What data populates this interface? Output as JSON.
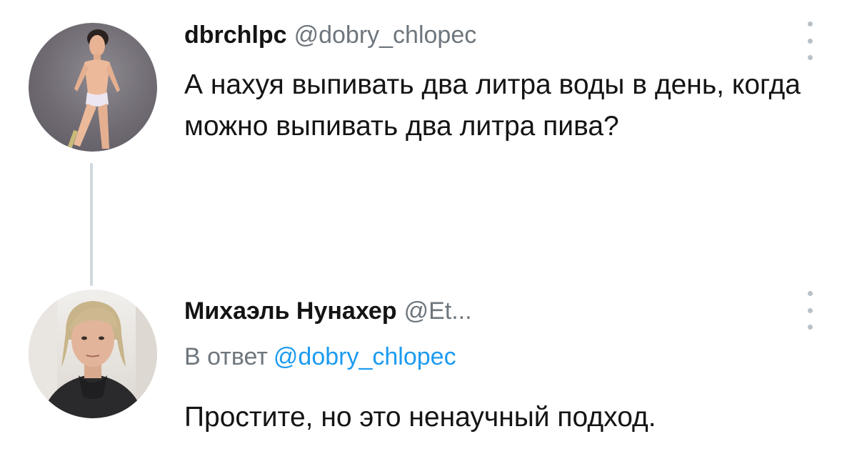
{
  "tweets": [
    {
      "display_name": "dbrchlpc",
      "handle": "@dobry_chlopec",
      "text": "А нахуя выпивать два литра воды в день, когда можно выпивать два литра пива?",
      "avatar_icon": "avatar-doll-figure",
      "more_icon": "more-options-icon"
    },
    {
      "display_name": "Михаэль Нунахер",
      "handle": "@Et...",
      "reply_prefix": "В ответ",
      "reply_to": "@dobry_chlopec",
      "text": "Простите, но это ненаучный подход.",
      "avatar_icon": "avatar-person-photo",
      "more_icon": "more-options-icon"
    }
  ],
  "colors": {
    "text": "#141414",
    "secondary": "#6e767d",
    "link": "#1d9bf0",
    "thread_line": "#cfd9de"
  }
}
